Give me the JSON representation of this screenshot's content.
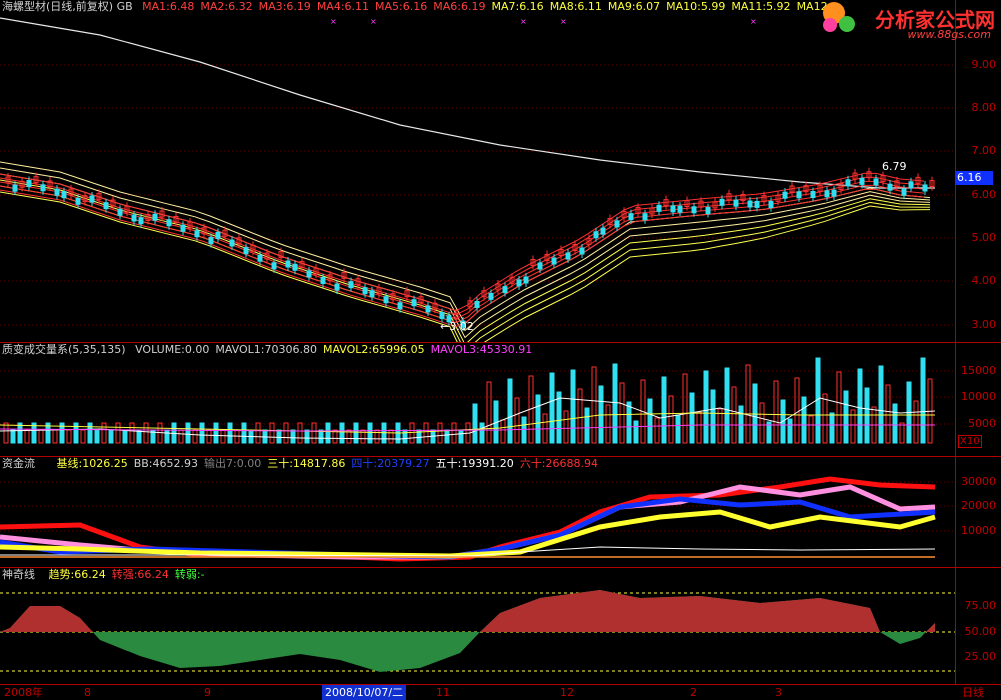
{
  "main": {
    "title": "海螺型材(日线,前复权) GB",
    "ma": [
      {
        "label": "MA1:6.48",
        "color": "#ff4040"
      },
      {
        "label": "MA2:6.32",
        "color": "#ff4040"
      },
      {
        "label": "MA3:6.19",
        "color": "#ff4040"
      },
      {
        "label": "MA4:6.11",
        "color": "#ff4040"
      },
      {
        "label": "MA5:6.16",
        "color": "#ff4040"
      },
      {
        "label": "MA6:6.19",
        "color": "#ff4040"
      },
      {
        "label": "MA7:6.16",
        "color": "#ffff40"
      },
      {
        "label": "MA8:6.11",
        "color": "#ffff40"
      },
      {
        "label": "MA9:6.07",
        "color": "#ffff40"
      },
      {
        "label": "MA10:5.99",
        "color": "#ffff40"
      },
      {
        "label": "MA11:5.92",
        "color": "#ffff40"
      },
      {
        "label": "MA12:",
        "color": "#ffff40"
      }
    ],
    "ticks": [
      "9.00",
      "8.00",
      "7.00",
      "6.00",
      "5.00",
      "4.00",
      "3.00"
    ],
    "current_price": "6.16",
    "high_label": "6.79",
    "low_label": "3.02"
  },
  "volume": {
    "title": "质变成交量系(5,35,135)",
    "items": [
      {
        "label": "VOLUME:0.00",
        "color": "#d0d0d0"
      },
      {
        "label": "MAVOL1:70306.80",
        "color": "#d0d0d0"
      },
      {
        "label": "MAVOL2:65996.05",
        "color": "#ffff40"
      },
      {
        "label": "MAVOL3:45330.91",
        "color": "#ff40ff"
      }
    ],
    "ticks": [
      "15000",
      "10000",
      "5000"
    ],
    "unit": "X10"
  },
  "fund": {
    "title": "资金流",
    "items": [
      {
        "label": "基线:1026.25",
        "color": "#ffff40"
      },
      {
        "label": "BB:4652.93",
        "color": "#d0d0d0"
      },
      {
        "label": "输出7:0.00",
        "color": "#808080"
      },
      {
        "label": "三十:14817.86",
        "color": "#ffff40"
      },
      {
        "label": "四十:20379.27",
        "color": "#2040ff"
      },
      {
        "label": "五十:19391.20",
        "color": "#ffffff"
      },
      {
        "label": "六十:26688.94",
        "color": "#ff3030"
      }
    ],
    "ticks": [
      "30000",
      "20000",
      "10000"
    ]
  },
  "magic": {
    "title": "神奇线",
    "items": [
      {
        "label": "趋势:66.24",
        "color": "#ffff40"
      },
      {
        "label": "转强:66.24",
        "color": "#ff3030"
      },
      {
        "label": "转弱:-",
        "color": "#40ff40"
      }
    ],
    "ticks": [
      "75.00",
      "50.00",
      "25.00"
    ]
  },
  "dates": {
    "labels": [
      "2008年",
      "8",
      "9",
      "2008/10/07/二",
      "11",
      "12",
      "2",
      "3"
    ],
    "period": "日线"
  },
  "logo": {
    "name": "分析家公式网",
    "url": "www.88gs.com"
  }
}
